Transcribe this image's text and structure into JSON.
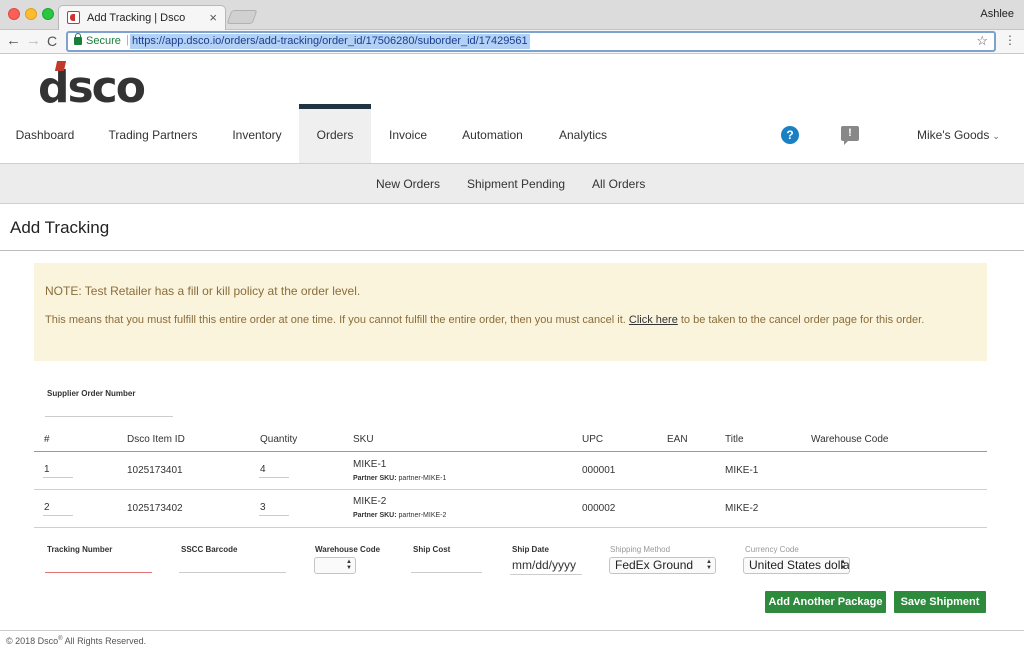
{
  "browser": {
    "tab_title": "Add Tracking | Dsco",
    "tab_close": "×",
    "user": "Ashlee",
    "secure_label": "Secure",
    "url_separator": "|",
    "url": "https://app.dsco.io/orders/add-tracking/order_id/17506280/suborder_id/17429561",
    "back": "←",
    "forward": "→",
    "reload": "C",
    "star": "☆",
    "menu": "⋮"
  },
  "brand": {
    "logo_text": "dsco",
    "accent_color": "#c0392b"
  },
  "main_nav": {
    "items": [
      "Dashboard",
      "Trading Partners",
      "Inventory",
      "Orders",
      "Invoice",
      "Automation",
      "Analytics"
    ],
    "active": "Orders",
    "help_glyph": "?",
    "alert_glyph": "!",
    "account": "Mike's Goods",
    "account_chevron": "⌄"
  },
  "sub_nav": {
    "items": [
      "New Orders",
      "Shipment Pending",
      "All Orders"
    ]
  },
  "page_title": "Add Tracking",
  "note": {
    "line1": "NOTE: Test Retailer has a fill or kill policy at the order level.",
    "line2_before": "This means that you must fulfill this entire order at one time. If you cannot fulfill the entire order, then you must cancel it.",
    "link": "Click here",
    "line2_after": "to be taken to the cancel order page for this order."
  },
  "form": {
    "supplier_order_label": "Supplier Order Number",
    "supplier_order_value": ""
  },
  "table": {
    "headers": [
      "#",
      "Dsco Item ID",
      "Quantity",
      "SKU",
      "UPC",
      "EAN",
      "Title",
      "Warehouse Code"
    ],
    "partner_sku_label": "Partner SKU:",
    "rows": [
      {
        "num": "1",
        "item_id": "1025173401",
        "quantity": "4",
        "sku": "MIKE-1",
        "partner_sku": "partner-MIKE-1",
        "upc": "000001",
        "ean": "",
        "title": "MIKE-1",
        "warehouse_code": ""
      },
      {
        "num": "2",
        "item_id": "1025173402",
        "quantity": "3",
        "sku": "MIKE-2",
        "partner_sku": "partner-MIKE-2",
        "upc": "000002",
        "ean": "",
        "title": "MIKE-2",
        "warehouse_code": ""
      }
    ]
  },
  "package": {
    "tracking_label": "Tracking Number",
    "tracking_value": "",
    "sscc_label": "SSCC Barcode",
    "sscc_value": "",
    "warehouse_label": "Warehouse Code",
    "warehouse_value": "",
    "ship_cost_label": "Ship Cost",
    "ship_cost_value": "",
    "ship_date_label": "Ship Date",
    "ship_date_placeholder": "mm/dd/yyyy",
    "shipping_method_label": "Shipping Method",
    "shipping_method_value": "FedEx Ground",
    "currency_label": "Currency Code",
    "currency_value": "United States dollar"
  },
  "buttons": {
    "add_package": "Add Another Package",
    "save_shipment": "Save Shipment"
  },
  "footer": {
    "before_sup": "© 2018 Dsco",
    "sup": "®",
    "after_sup": " All Rights Reserved."
  }
}
